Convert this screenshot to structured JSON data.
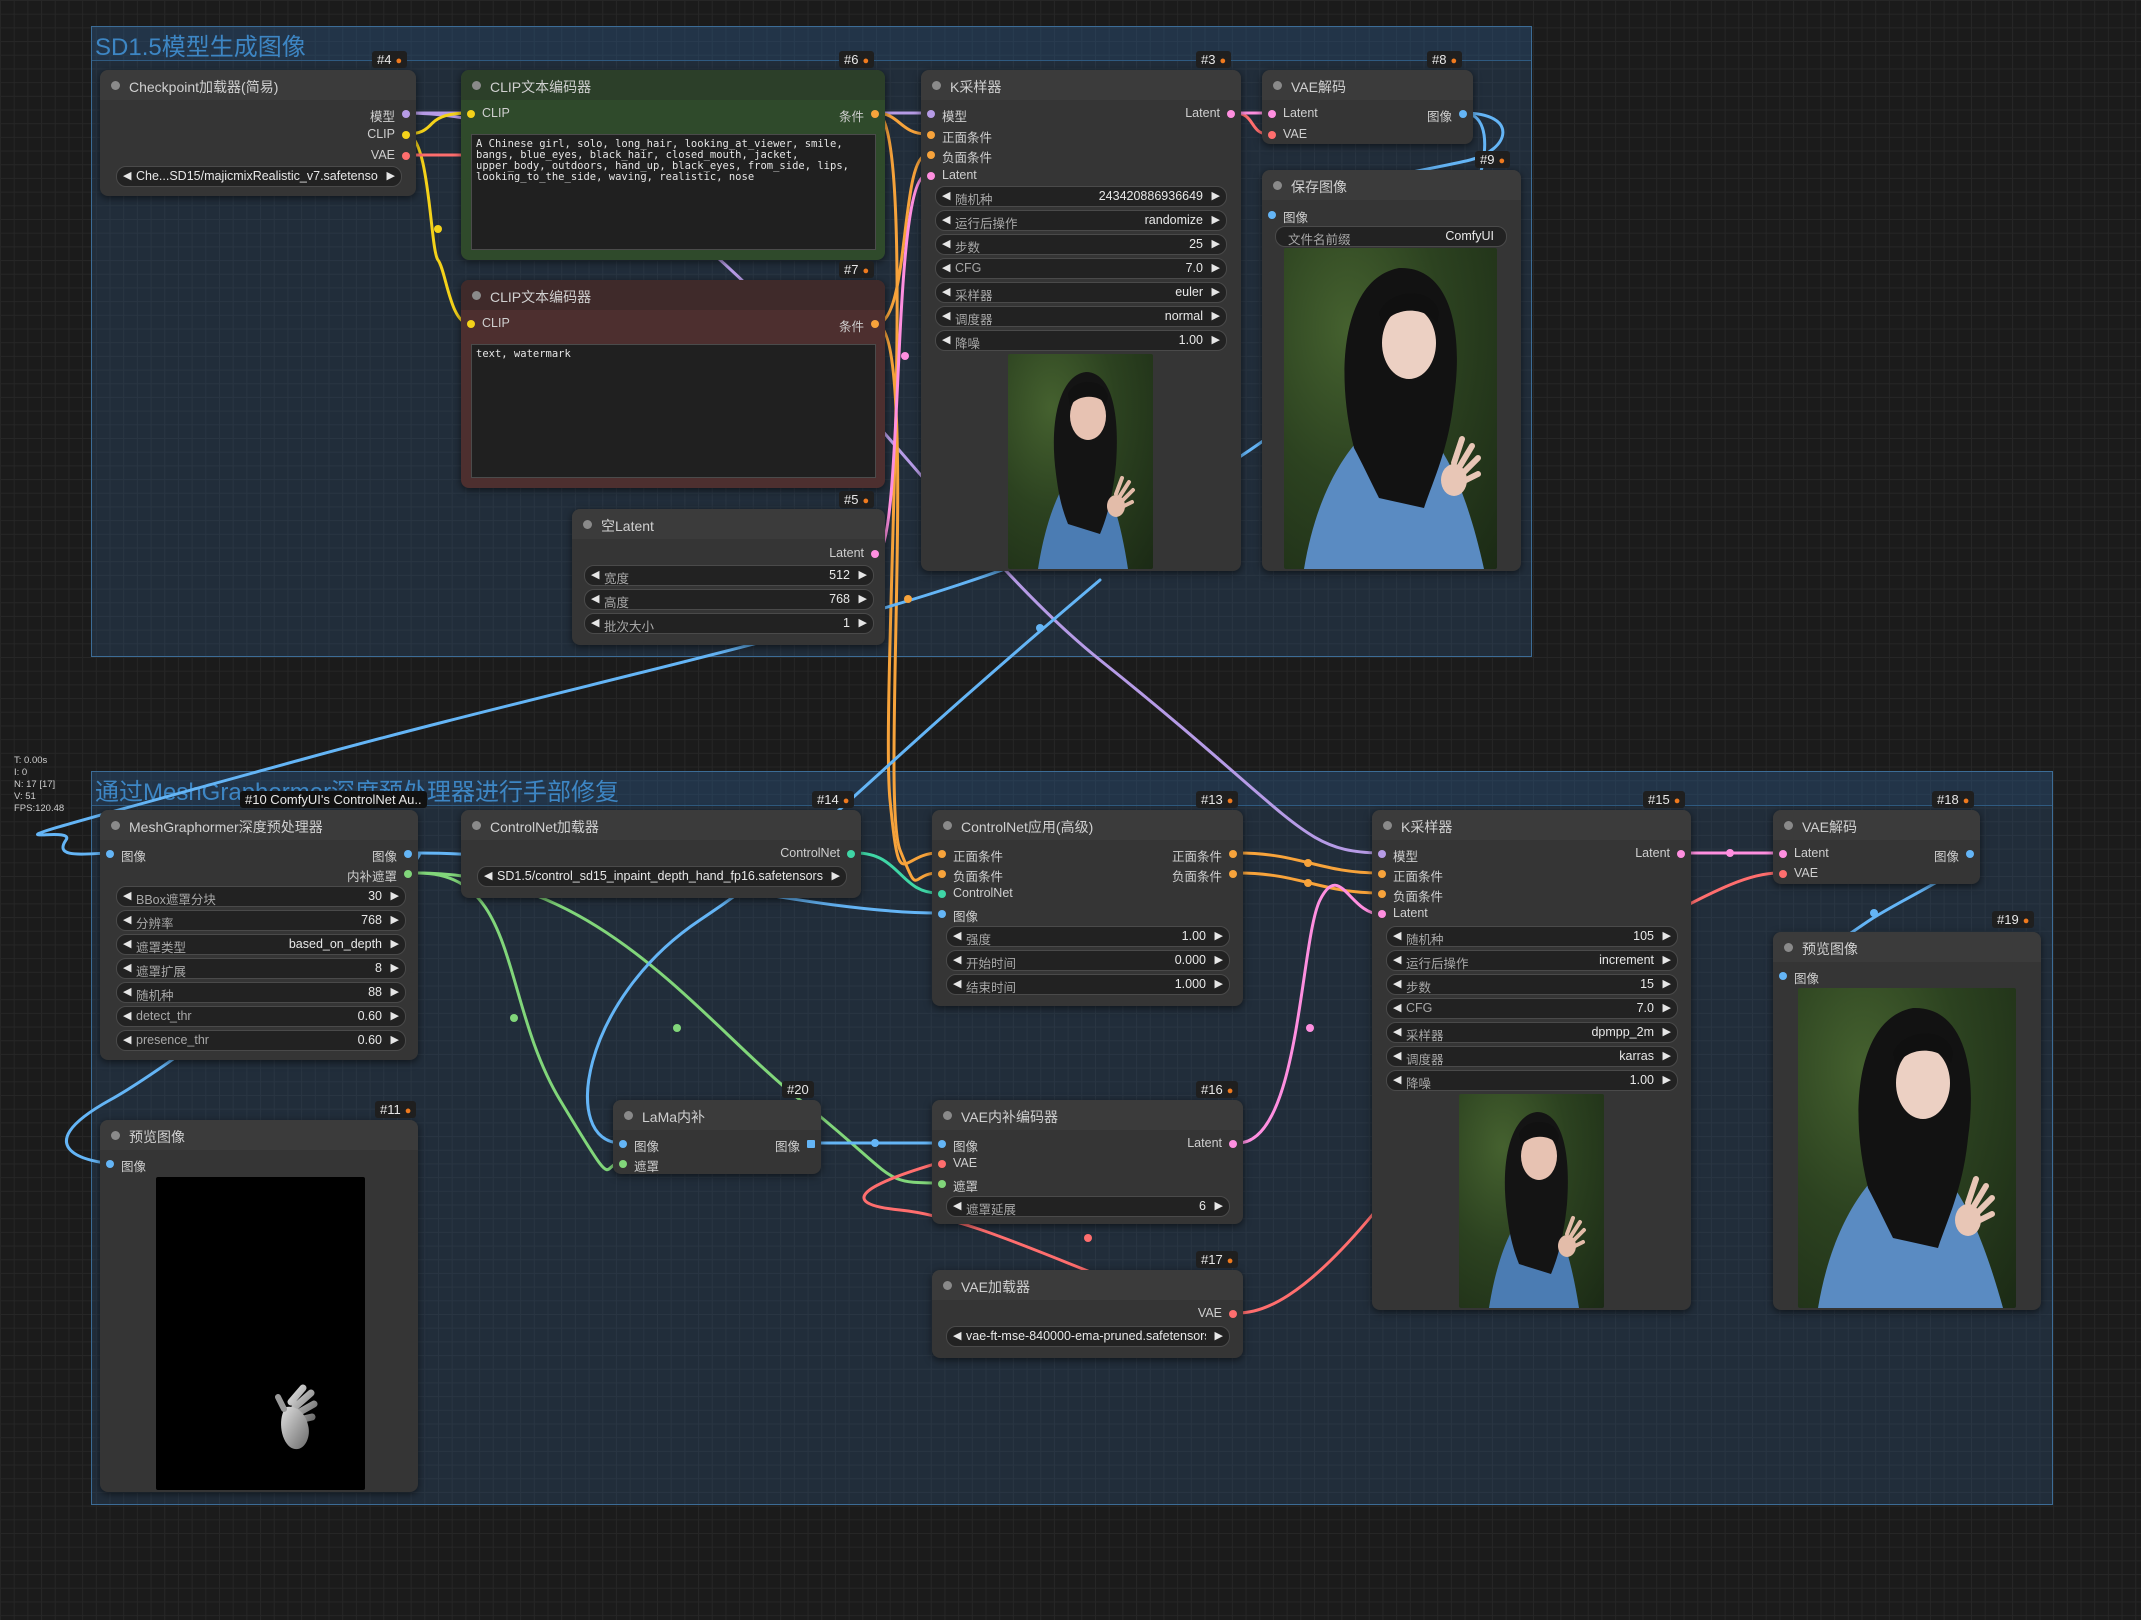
{
  "groups": {
    "top": {
      "title": "SD1.5模型生成图像"
    },
    "bottom": {
      "title": "通过MeshGraphormer深度预处理器进行手部修复"
    }
  },
  "stats": [
    "T: 0.00s",
    "I: 0",
    "N: 17 [17]",
    "V: 51",
    "FPS:120.48"
  ],
  "colors": {
    "model_pin": "#b69be6",
    "clip_pin": "#f4d21a",
    "vae_pin": "#ff6e6e",
    "conditioning_pin": "#f7a33b",
    "latent_pin": "#ff8fe0",
    "image_pin": "#64b5f6",
    "mask_pin": "#81d67a",
    "controlnet_pin": "#3fd6a6",
    "positive_header": "#2c4a2c",
    "negative_header": "#4a2d2d"
  },
  "nodes": {
    "n4": {
      "badge": "#4",
      "title": "Checkpoint加载器(简易)",
      "outputs": [
        "模型",
        "CLIP",
        "VAE"
      ],
      "ckpt_value": "Che...SD15/majicmixRealistic_v7.safetensors"
    },
    "n6": {
      "badge": "#6",
      "title": "CLIP文本编码器",
      "input": "CLIP",
      "output": "条件",
      "text": "A Chinese girl, solo, long_hair, looking_at_viewer, smile, bangs, blue_eyes, black_hair, closed_mouth, jacket, upper_body, outdoors, hand_up, black_eyes, from_side, lips, looking_to_the_side, waving, realistic, nose"
    },
    "n7": {
      "badge": "#7",
      "title": "CLIP文本编码器",
      "input": "CLIP",
      "output": "条件",
      "text": "text, watermark"
    },
    "n5": {
      "badge": "#5",
      "title": "空Latent",
      "output": "Latent",
      "widgets": [
        {
          "label": "宽度",
          "value": "512"
        },
        {
          "label": "高度",
          "value": "768"
        },
        {
          "label": "批次大小",
          "value": "1"
        }
      ]
    },
    "n3": {
      "badge": "#3",
      "title": "K采样器",
      "inputs": [
        "模型",
        "正面条件",
        "负面条件",
        "Latent"
      ],
      "output": "Latent",
      "widgets": [
        {
          "label": "随机种",
          "value": "243420886936649"
        },
        {
          "label": "运行后操作",
          "value": "randomize"
        },
        {
          "label": "步数",
          "value": "25"
        },
        {
          "label": "CFG",
          "value": "7.0"
        },
        {
          "label": "采样器",
          "value": "euler"
        },
        {
          "label": "调度器",
          "value": "normal"
        },
        {
          "label": "降噪",
          "value": "1.00"
        }
      ]
    },
    "n8": {
      "badge": "#8",
      "title": "VAE解码",
      "inputs": [
        "Latent",
        "VAE"
      ],
      "output": "图像"
    },
    "n9": {
      "badge": "#9",
      "title": "保存图像",
      "input": "图像",
      "widget": {
        "label": "文件名前缀",
        "value": "ComfyUI"
      }
    },
    "n10": {
      "badge": "#10 ComfyUI's ControlNet Au..",
      "title": "MeshGraphormer深度预处理器",
      "input": "图像",
      "outputs": [
        "图像",
        "内补遮罩"
      ],
      "widgets": [
        {
          "label": "BBox遮罩分块",
          "value": "30"
        },
        {
          "label": "分辨率",
          "value": "768"
        },
        {
          "label": "遮罩类型",
          "value": "based_on_depth"
        },
        {
          "label": "遮罩扩展",
          "value": "8"
        },
        {
          "label": "随机种",
          "value": "88"
        },
        {
          "label": "detect_thr",
          "value": "0.60"
        },
        {
          "label": "presence_thr",
          "value": "0.60"
        }
      ]
    },
    "n14": {
      "badge": "#14",
      "title": "ControlNet加载器",
      "output": "ControlNet",
      "value": "SD1.5/control_sd15_inpaint_depth_hand_fp16.safetensors"
    },
    "n13": {
      "badge": "#13",
      "title": "ControlNet应用(高级)",
      "inputs": [
        "正面条件",
        "负面条件",
        "ControlNet",
        "图像"
      ],
      "outputs": [
        "正面条件",
        "负面条件"
      ],
      "widgets": [
        {
          "label": "强度",
          "value": "1.00"
        },
        {
          "label": "开始时间",
          "value": "0.000"
        },
        {
          "label": "结束时间",
          "value": "1.000"
        }
      ]
    },
    "n15": {
      "badge": "#15",
      "title": "K采样器",
      "inputs": [
        "模型",
        "正面条件",
        "负面条件",
        "Latent"
      ],
      "output": "Latent",
      "widgets": [
        {
          "label": "随机种",
          "value": "105"
        },
        {
          "label": "运行后操作",
          "value": "increment"
        },
        {
          "label": "步数",
          "value": "15"
        },
        {
          "label": "CFG",
          "value": "7.0"
        },
        {
          "label": "采样器",
          "value": "dpmpp_2m"
        },
        {
          "label": "调度器",
          "value": "karras"
        },
        {
          "label": "降噪",
          "value": "1.00"
        }
      ]
    },
    "n18": {
      "badge": "#18",
      "title": "VAE解码",
      "inputs": [
        "Latent",
        "VAE"
      ],
      "output": "图像"
    },
    "n19": {
      "badge": "#19",
      "title": "预览图像",
      "input": "图像"
    },
    "n11": {
      "badge": "#11",
      "title": "预览图像",
      "input": "图像"
    },
    "n20": {
      "badge": "#20",
      "title": "LaMa内补",
      "inputs": [
        "图像",
        "遮罩"
      ],
      "output": "图像"
    },
    "n16": {
      "badge": "#16",
      "title": "VAE内补编码器",
      "inputs": [
        "图像",
        "VAE",
        "遮罩"
      ],
      "output": "Latent",
      "widget": {
        "label": "遮罩延展",
        "value": "6"
      }
    },
    "n17": {
      "badge": "#17",
      "title": "VAE加载器",
      "output": "VAE",
      "value": "vae-ft-mse-840000-ema-pruned.safetensors"
    }
  }
}
